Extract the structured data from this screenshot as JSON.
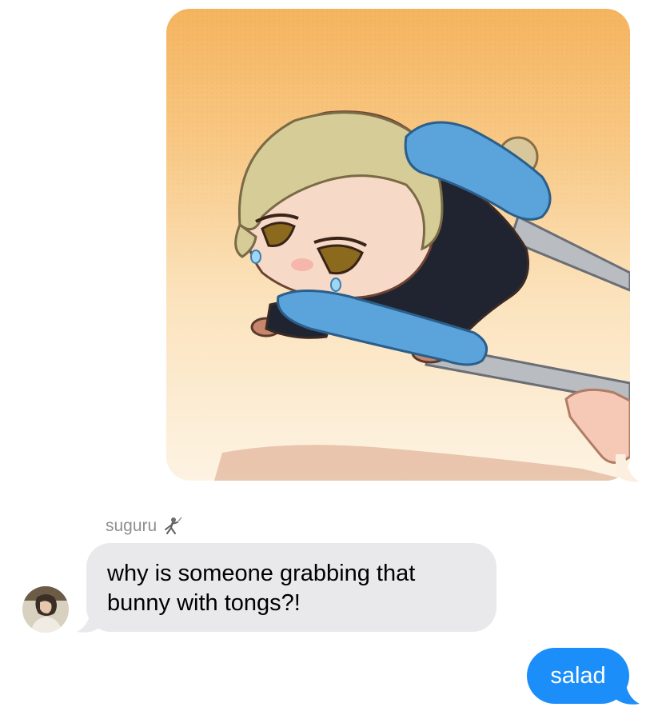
{
  "colors": {
    "sent_bubble": "#1c8ef9",
    "received_bubble": "#e9e9eb",
    "sender_name": "#8e8e93",
    "background": "#ffffff"
  },
  "messages": {
    "sent_image": {
      "icon": "chibi-character-held-by-tongs-illustration"
    },
    "received": {
      "sender_name": "suguru",
      "sender_emoji_icon": "fencing-person-icon",
      "avatar_icon": "contact-avatar-photo",
      "text_line_1": "why is someone grabbing that",
      "text_line_2": "bunny with tongs?!"
    },
    "sent_text": {
      "text": "salad"
    }
  }
}
